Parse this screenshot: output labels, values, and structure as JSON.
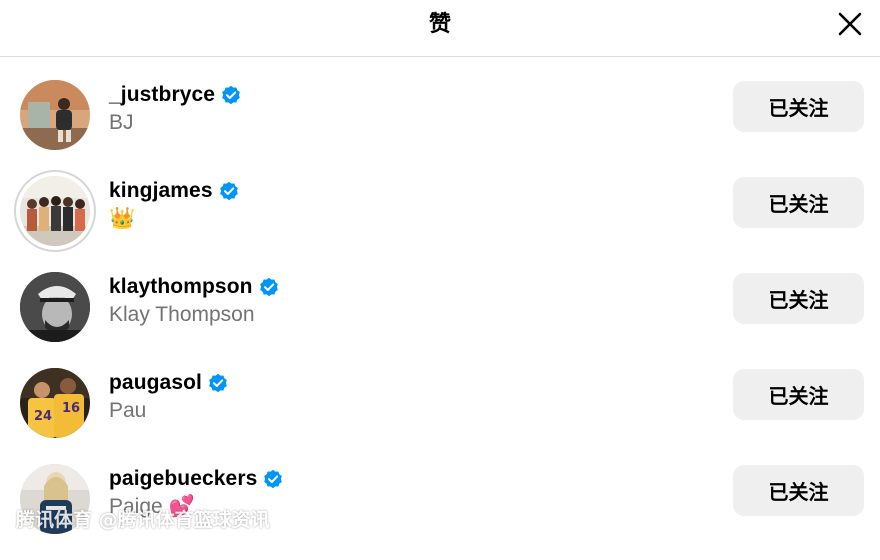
{
  "dialog": {
    "title": "赞",
    "close_icon": "close-icon"
  },
  "colors": {
    "verified_badge": "#0095f6",
    "button_bg": "#efefef",
    "subtitle_text": "#737373"
  },
  "users": [
    {
      "username": "_justbryce",
      "subtitle": "BJ",
      "verified": true,
      "button": "已关注"
    },
    {
      "username": "kingjames",
      "subtitle": "👑",
      "verified": true,
      "button": "已关注",
      "has_story_ring": true
    },
    {
      "username": "klaythompson",
      "subtitle": "Klay Thompson",
      "verified": true,
      "button": "已关注"
    },
    {
      "username": "paugasol",
      "subtitle": "Pau",
      "verified": true,
      "button": "已关注"
    },
    {
      "username": "paigebueckers",
      "subtitle": "Paige 💕",
      "verified": true,
      "button": "已关注"
    }
  ],
  "watermark": "腾讯体育 @腾讯体育篮球资讯"
}
